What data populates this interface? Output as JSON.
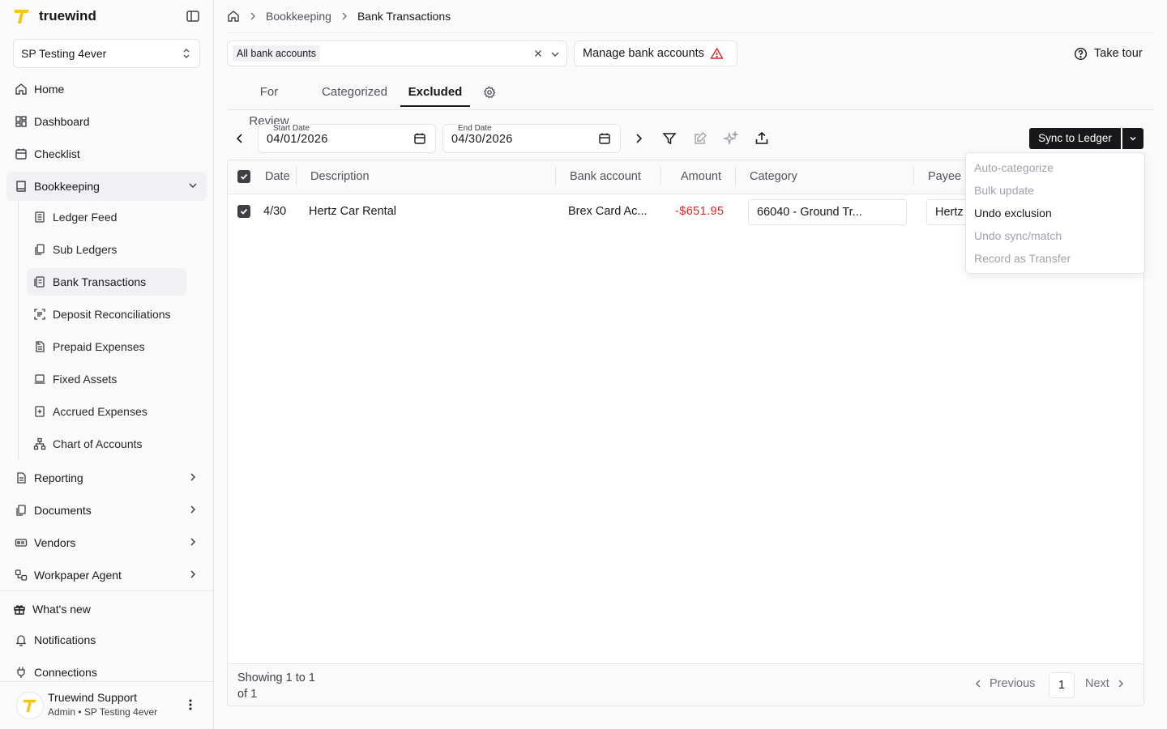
{
  "app": {
    "name": "truewind"
  },
  "sidebar": {
    "org": "SP Testing 4ever",
    "items": [
      {
        "label": "Home",
        "icon": "home-icon"
      },
      {
        "label": "Dashboard",
        "icon": "dashboard-icon"
      },
      {
        "label": "Checklist",
        "icon": "calendar-icon"
      },
      {
        "label": "Bookkeeping",
        "icon": "book-icon"
      }
    ],
    "sub_items": [
      {
        "label": "Ledger Feed",
        "icon": "ledger-icon"
      },
      {
        "label": "Sub Ledgers",
        "icon": "copy-icon"
      },
      {
        "label": "Bank Transactions",
        "icon": "receipt-icon"
      },
      {
        "label": "Deposit Reconciliations",
        "icon": "scan-icon"
      },
      {
        "label": "Prepaid Expenses",
        "icon": "document-icon"
      },
      {
        "label": "Fixed Assets",
        "icon": "laptop-icon"
      },
      {
        "label": "Accrued Expenses",
        "icon": "plus-document-icon"
      },
      {
        "label": "Chart of Accounts",
        "icon": "hierarchy-icon"
      }
    ],
    "more_items": [
      {
        "label": "Reporting",
        "icon": "report-icon"
      },
      {
        "label": "Documents",
        "icon": "files-icon"
      },
      {
        "label": "Vendors",
        "icon": "vendor-icon"
      },
      {
        "label": "Workpaper Agent",
        "icon": "agent-icon"
      }
    ],
    "footer_items": [
      {
        "label": "What's new",
        "icon": "gift-icon"
      },
      {
        "label": "Notifications",
        "icon": "bell-icon"
      },
      {
        "label": "Connections",
        "icon": "plug-icon"
      }
    ],
    "user": {
      "name": "Truewind Support",
      "role": "Admin • SP Testing 4ever"
    }
  },
  "breadcrumb": {
    "parent": "Bookkeeping",
    "current": "Bank Transactions"
  },
  "filters": {
    "account_chip": "All bank accounts",
    "manage_label": "Manage bank accounts",
    "tour_label": "Take tour"
  },
  "tabs": [
    "For Review",
    "Categorized",
    "Excluded"
  ],
  "dates": {
    "start_label": "Start Date",
    "start_value": "04/01/2026",
    "end_label": "End Date",
    "end_value": "04/30/2026"
  },
  "sync_label": "Sync to Ledger",
  "table": {
    "headers": {
      "date": "Date",
      "description": "Description",
      "bank": "Bank account",
      "amount": "Amount",
      "category": "Category",
      "payee": "Payee"
    },
    "rows": [
      {
        "date": "4/30",
        "description": "Hertz Car Rental",
        "bank": "Brex Card Ac...",
        "amount": "-$651.95",
        "category": "66040 - Ground Tr...",
        "payee": "Hertz"
      }
    ],
    "showing": "Showing 1 to 1 of 1"
  },
  "pagination": {
    "previous": "Previous",
    "page": "1",
    "next": "Next"
  },
  "dropdown": [
    {
      "label": "Auto-categorize",
      "enabled": false
    },
    {
      "label": "Bulk update",
      "enabled": false
    },
    {
      "label": "Undo exclusion",
      "enabled": true
    },
    {
      "label": "Undo sync/match",
      "enabled": false
    },
    {
      "label": "Record as Transfer",
      "enabled": false
    }
  ],
  "colors": {
    "brand": "#f5c518",
    "negative": "#dc2626",
    "dark": "#18181b"
  }
}
